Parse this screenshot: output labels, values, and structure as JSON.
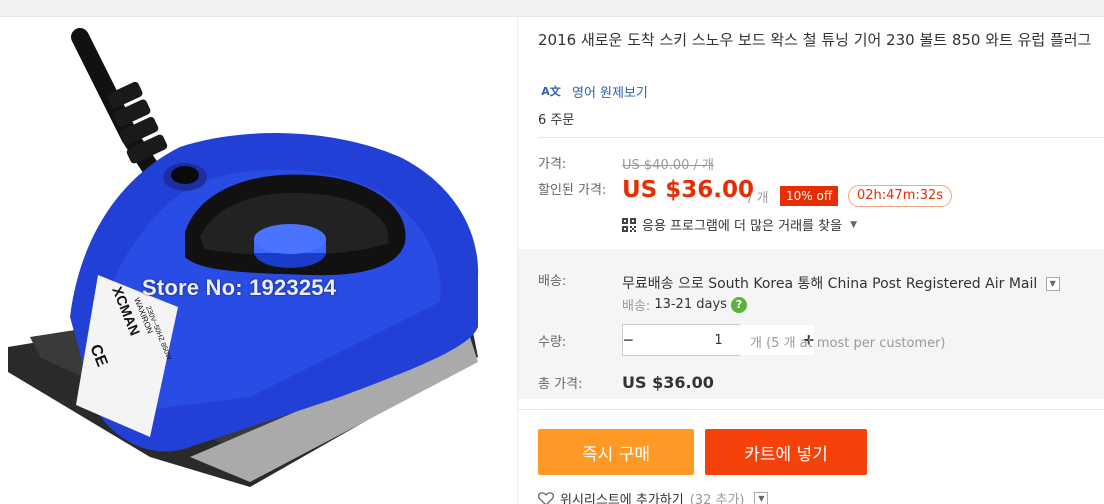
{
  "image": {
    "watermark": "Store No: 1923254",
    "brand": "XCMAN",
    "product_label": "WAXIRON",
    "spec_label": "230V~50HZ 850W",
    "ce_mark": "CE"
  },
  "product": {
    "title": "2016 새로운 도착 스키 스노우 보드 왁스 철 튜닝 기어 230 볼트 850 와트 유럽 플러그",
    "translate_icon": "A文",
    "translate_link": "영어 원제보기",
    "orders": "6 주문"
  },
  "price": {
    "original_label": "가격:",
    "original_value": "US $40.00 / 개",
    "sale_label": "할인된 가격:",
    "sale_value": "US $36.00",
    "sale_unit": "/ 개",
    "discount_badge": "10% off",
    "countdown": "02h:47m:32s",
    "app_deal": "응용 프로그램에 더 많은 거래를 찾을",
    "accent_color": "#e62e04"
  },
  "shipping": {
    "label": "배송:",
    "method_prefix": "무료배송",
    "method_text": "으로 South Korea 통해 China Post Registered Air Mail",
    "days_label": "배송:",
    "days_value": "13-21 days",
    "help_icon": "?"
  },
  "quantity": {
    "label": "수량:",
    "minus": "−",
    "value": "1",
    "plus": "+",
    "note": "개 (5 개 at most per customer)"
  },
  "total": {
    "label": "총 가격:",
    "value": "US $36.00"
  },
  "actions": {
    "buy_now": "즉시 구매",
    "add_to_cart": "카트에 넣기",
    "buy_color": "#ff9926",
    "cart_color": "#f5420a"
  },
  "wishlist": {
    "label": "위시리스트에 추가하기",
    "count": "(32 추가)"
  }
}
